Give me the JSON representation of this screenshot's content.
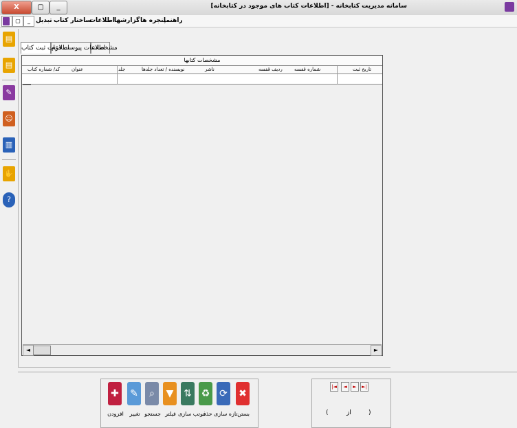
{
  "window": {
    "title": "سامانه مدیریت کتابخانه - [اطلاعات کتاب های موجود در کتابخانه]",
    "close_label": "X",
    "max_label": "▢",
    "min_label": "_"
  },
  "menubar": {
    "items": [
      "تبدیل",
      "ساختار کتاب",
      "اطلاعات",
      "گزارشها",
      "پنجره ها",
      "راهنما"
    ],
    "system_icons": [
      "x",
      "▢",
      "_"
    ]
  },
  "tabs": [
    "مشخصات",
    "اطلاعات پیوست فرم",
    "اطلاعات ثبت کتاب"
  ],
  "grid": {
    "caption": "مشخصات کتابها",
    "columns": [
      "تاریخ ثبت",
      "شماره قفسه",
      "ردیف قفسه",
      "ناشر",
      "نویسنده / تعداد جلدها",
      "جلد",
      "عنوان",
      "کد/ شماره کتاب"
    ],
    "scroll_left": "◄",
    "scroll_right": "►"
  },
  "actions": [
    {
      "label": "افزودن",
      "icon": "add-icon"
    },
    {
      "label": "تغییر",
      "icon": "edit-icon"
    },
    {
      "label": "جستجو",
      "icon": "search-icon"
    },
    {
      "label": "فیلتر",
      "icon": "filter-icon"
    },
    {
      "label": "مرتب سازی",
      "icon": "sort-icon"
    },
    {
      "label": "حذف",
      "icon": "delete-icon"
    },
    {
      "label": "تازه سازی",
      "icon": "refresh-icon"
    },
    {
      "label": "بستن",
      "icon": "close-icon"
    }
  ],
  "navigation": {
    "first": "|◄",
    "prev": "◄",
    "next": "►",
    "last": "►|",
    "position": "(",
    "separator": "از",
    "total": ")"
  },
  "colors": {
    "accent": "#c00000",
    "toolbar_yellow": "#e8a400",
    "toolbar_blue": "#2a62b8"
  }
}
